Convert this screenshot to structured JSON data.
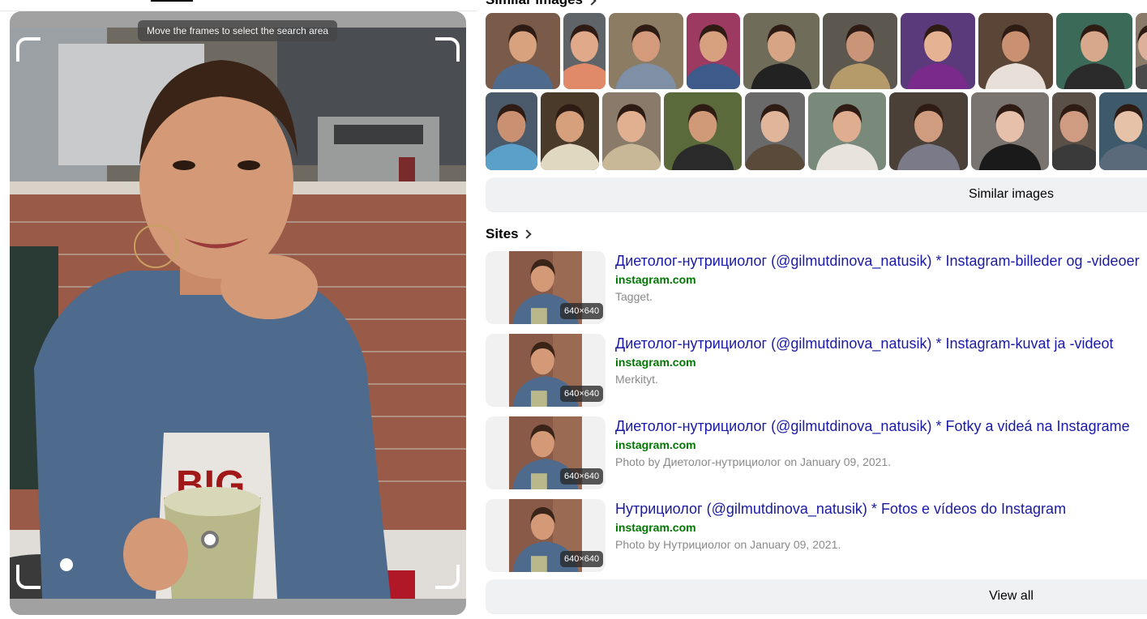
{
  "crop": {
    "hint": "Move the frames to select the search area"
  },
  "similar": {
    "section_title": "Similar images",
    "button_label": "Similar images",
    "row1": [
      {
        "bg": "#7a5a48",
        "skin": "#d9a27f",
        "shirt": "#4e6b8e"
      },
      {
        "bg": "#5f6468",
        "skin": "#e0a98a",
        "shirt": "#e08a6a"
      },
      {
        "bg": "#8c7c64",
        "skin": "#d39b7c",
        "shirt": "#7f8fa6"
      },
      {
        "bg": "#9c3a62",
        "skin": "#d7a07f",
        "shirt": "#3d5a8a"
      },
      {
        "bg": "#6f6d5a",
        "skin": "#d7a585",
        "shirt": "#222222"
      },
      {
        "bg": "#5c5850",
        "skin": "#c99478",
        "shirt": "#b59a6a"
      },
      {
        "bg": "#5a3a7a",
        "skin": "#e6b294",
        "shirt": "#7a2a8a"
      },
      {
        "bg": "#5a4536",
        "skin": "#c99072",
        "shirt": "#e8e0d8"
      },
      {
        "bg": "#3c6a58",
        "skin": "#d8a88c",
        "shirt": "#2a2a2a"
      },
      {
        "bg": "#8a7a6a",
        "skin": "#dcb09a",
        "shirt": "#4a4a4a"
      }
    ],
    "row2": [
      {
        "bg": "#4a5a6a",
        "skin": "#c99072",
        "shirt": "#5aa0c8"
      },
      {
        "bg": "#4a3a2a",
        "skin": "#d6a07c",
        "shirt": "#e0d8c0"
      },
      {
        "bg": "#8a7a6a",
        "skin": "#e0b090",
        "shirt": "#c8b898"
      },
      {
        "bg": "#5a6a3a",
        "skin": "#d09a78",
        "shirt": "#2a2a2a"
      },
      {
        "bg": "#6a6a6a",
        "skin": "#e0b59a",
        "shirt": "#5a4a3a"
      },
      {
        "bg": "#7a8a7a",
        "skin": "#dfae90",
        "shirt": "#e8e4dc"
      },
      {
        "bg": "#4a4038",
        "skin": "#d09c80",
        "shirt": "#7a7a88"
      },
      {
        "bg": "#7a7470",
        "skin": "#e6c0aa",
        "shirt": "#1a1a1a"
      },
      {
        "bg": "#5a5048",
        "skin": "#cf9c82",
        "shirt": "#3a3a3a"
      },
      {
        "bg": "#3e5a6a",
        "skin": "#e6c2a8",
        "shirt": "#5a6a7a"
      }
    ]
  },
  "sites": {
    "title": "Sites",
    "items": [
      {
        "title": "Диетолог-нутрициолог (@gilmutdinova_natusik) * Instagram-billeder og -videoer",
        "domain": "instagram.com",
        "desc": "Tagget.",
        "size": "640×640"
      },
      {
        "title": "Диетолог-нутрициолог (@gilmutdinova_natusik) * Instagram-kuvat ja -videot",
        "domain": "instagram.com",
        "desc": "Merkityt.",
        "size": "640×640"
      },
      {
        "title": "Диетолог-нутрициолог (@gilmutdinova_natusik) * Fotky a videá na Instagrame",
        "domain": "instagram.com",
        "desc": "Photo by Диетолог-нутрициолог on January 09, 2021.",
        "size": "640×640"
      },
      {
        "title": "Нутрициолог (@gilmutdinova_natusik) * Fotos e vídeos do Instagram",
        "domain": "instagram.com",
        "desc": "Photo by Нутрициолог on January 09, 2021.",
        "size": "640×640"
      }
    ],
    "view_all_label": "View all"
  }
}
